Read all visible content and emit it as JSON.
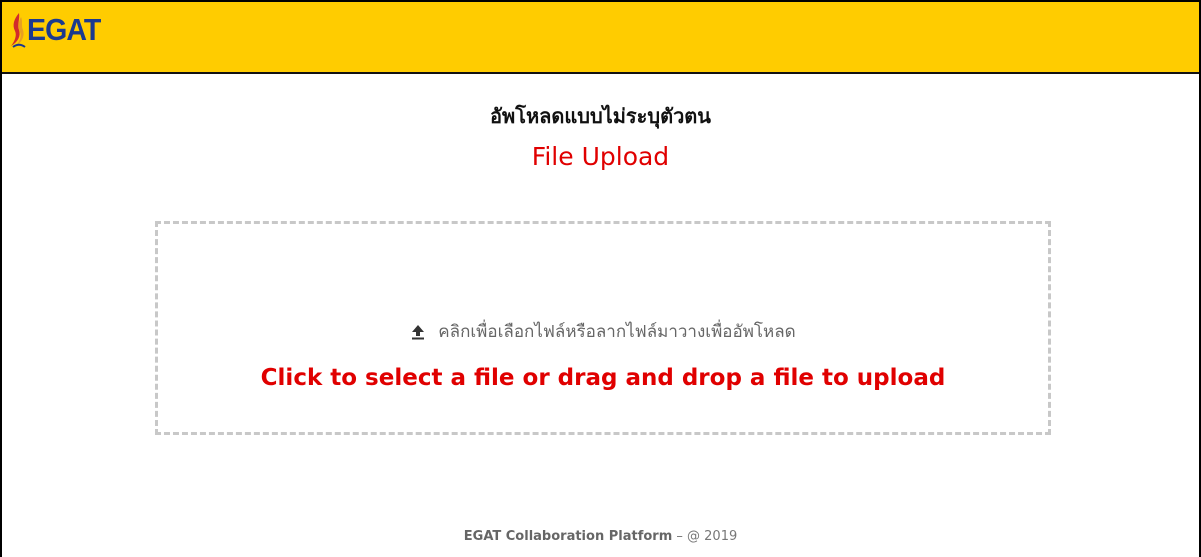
{
  "header": {
    "logo_text": "EGAT",
    "brand_color": "#ffcc00",
    "logo_color": "#1b3a8f",
    "logo_icon": "egat-torch-icon"
  },
  "main": {
    "title_th": "อัพโหลดแบบไม่ระบุตัวตน",
    "title_en": "File Upload"
  },
  "dropzone": {
    "icon": "upload-icon",
    "label_th": "คลิกเพื่อเลือกไฟล์หรือลากไฟล์มาวางเพื่ออัพโหลด",
    "label_en": "Click to select a file or drag and drop a file to upload",
    "accent_color": "#e00000"
  },
  "footer": {
    "platform": "EGAT Collaboration Platform",
    "suffix": " – @ 2019"
  }
}
